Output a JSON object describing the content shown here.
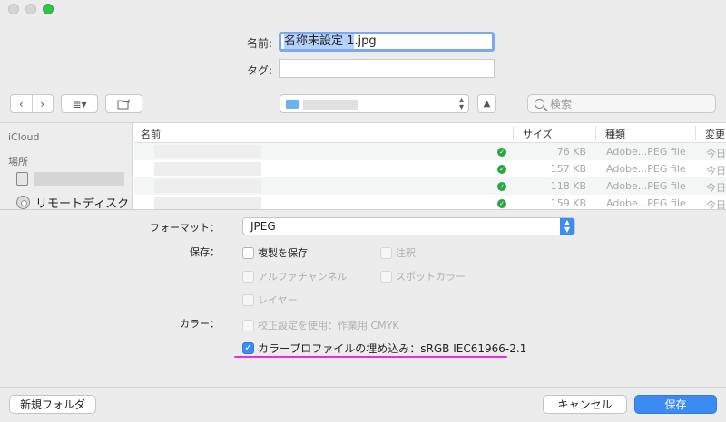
{
  "save_panel": {
    "name_label": "名前:",
    "name_value_selected": "名称未設定 1",
    "name_value_ext": ".jpg",
    "tags_label": "タグ:"
  },
  "toolbar": {
    "back_glyph": "‹",
    "forward_glyph": "›",
    "view_glyph": "≣▾",
    "search_placeholder": "検索"
  },
  "sidebar": {
    "icloud_header": "iCloud",
    "locations_header": "場所",
    "remote_disc_label": "リモートディスク"
  },
  "file_list": {
    "columns": {
      "name": "名前",
      "size": "サイズ",
      "kind": "種類",
      "date": "変更日"
    },
    "rows": [
      {
        "size": "76 KB",
        "kind": "Adobe...PEG file",
        "date": "今日"
      },
      {
        "size": "157 KB",
        "kind": "Adobe...PEG file",
        "date": "今日"
      },
      {
        "size": "118 KB",
        "kind": "Adobe...PEG file",
        "date": "今日"
      },
      {
        "size": "159 KB",
        "kind": "Adobe...PEG file",
        "date": "今日"
      }
    ]
  },
  "options": {
    "format_label": "フォーマット：",
    "format_value": "JPEG",
    "save_label": "保存：",
    "copy_label": "複製を保存",
    "annotations_label": "注釈",
    "alpha_label": "アルファチャンネル",
    "spot_label": "スポットカラー",
    "layers_label": "レイヤー",
    "color_label": "カラー：",
    "proof_label": "校正設定を使用：作業用 CMYK",
    "profile_label": "カラープロファイルの埋め込み：sRGB IEC61966-2.1",
    "profile_checked": true
  },
  "buttons": {
    "new_folder": "新規フォルダ",
    "cancel": "キャンセル",
    "save": "保存"
  },
  "colors": {
    "accent": "#3b8bf3",
    "highlight_underline": "#e52ee0",
    "status_green": "#27a646"
  }
}
